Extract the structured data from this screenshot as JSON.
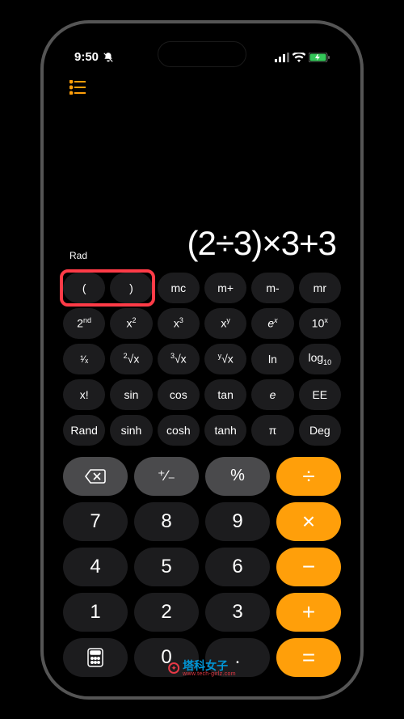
{
  "status": {
    "time": "9:50",
    "signal": 4,
    "wifi": true,
    "battery_charging": true
  },
  "mode_label": "Rad",
  "expression": "(2÷3)×3+3",
  "sci_rows": [
    [
      "(",
      ")",
      "mc",
      "m+",
      "m-",
      "mr"
    ],
    [
      "2ⁿᵈ",
      "x²",
      "x³",
      "xʸ",
      "eˣ",
      "10ˣ"
    ],
    [
      "¹⁄ₓ",
      "²√x",
      "³√x",
      "ʸ√x",
      "ln",
      "log₁₀"
    ],
    [
      "x!",
      "sin",
      "cos",
      "tan",
      "e",
      "EE"
    ],
    [
      "Rand",
      "sinh",
      "cosh",
      "tanh",
      "π",
      "Deg"
    ]
  ],
  "main_rows": [
    [
      {
        "label": "⌫",
        "type": "func",
        "name": "backspace"
      },
      {
        "label": "⁺∕₋",
        "type": "func",
        "name": "plus-minus"
      },
      {
        "label": "%",
        "type": "func",
        "name": "percent"
      },
      {
        "label": "÷",
        "type": "op",
        "name": "divide"
      }
    ],
    [
      {
        "label": "7",
        "type": "num",
        "name": "seven"
      },
      {
        "label": "8",
        "type": "num",
        "name": "eight"
      },
      {
        "label": "9",
        "type": "num",
        "name": "nine"
      },
      {
        "label": "×",
        "type": "op",
        "name": "multiply"
      }
    ],
    [
      {
        "label": "4",
        "type": "num",
        "name": "four"
      },
      {
        "label": "5",
        "type": "num",
        "name": "five"
      },
      {
        "label": "6",
        "type": "num",
        "name": "six"
      },
      {
        "label": "−",
        "type": "op",
        "name": "minus"
      }
    ],
    [
      {
        "label": "1",
        "type": "num",
        "name": "one"
      },
      {
        "label": "2",
        "type": "num",
        "name": "two"
      },
      {
        "label": "3",
        "type": "num",
        "name": "three"
      },
      {
        "label": "+",
        "type": "op",
        "name": "plus"
      }
    ],
    [
      {
        "label": "calc",
        "type": "num",
        "name": "calculator-mode",
        "icon": true
      },
      {
        "label": "0",
        "type": "num",
        "name": "zero"
      },
      {
        "label": ".",
        "type": "num",
        "name": "decimal"
      },
      {
        "label": "=",
        "type": "op",
        "name": "equals"
      }
    ]
  ],
  "watermark": {
    "cn": "塔科女子",
    "en": "www.tech-girlz.com"
  }
}
